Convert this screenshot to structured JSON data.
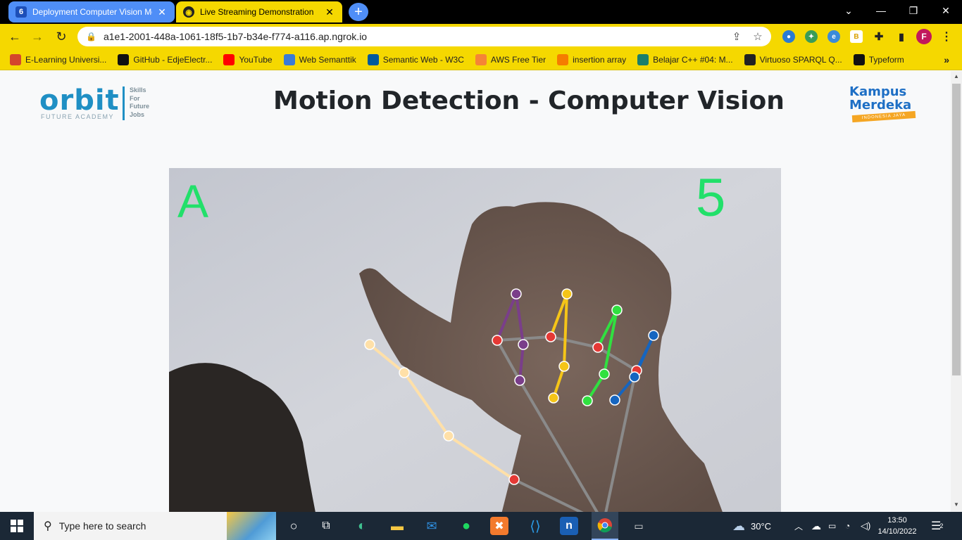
{
  "browser": {
    "tabs": [
      {
        "title": "Deployment Computer Vision Mo",
        "badge": "6",
        "close": "✕",
        "active": false
      },
      {
        "title": "Live Streaming Demonstration",
        "badge": "",
        "close": "✕",
        "active": true
      }
    ],
    "new_tab": "+",
    "window_controls": [
      "⌄",
      "—",
      "❐",
      "✕"
    ],
    "url": "a1e1-2001-448a-1061-18f5-1b7-b34e-f774-a116.ap.ngrok.io",
    "profile_initial": "F",
    "bookmarks": [
      {
        "label": "E-Learning Universi...",
        "icon": "graduation-cap-icon",
        "color": "#d4462c"
      },
      {
        "label": "GitHub - EdjeElectr...",
        "icon": "github-icon",
        "color": "#111111"
      },
      {
        "label": "YouTube",
        "icon": "youtube-icon",
        "color": "#ff0000"
      },
      {
        "label": "Web Semanttik",
        "icon": "network-icon",
        "color": "#3a7bd5"
      },
      {
        "label": "Semantic Web - W3C",
        "icon": "w3c-icon",
        "color": "#005a9c"
      },
      {
        "label": "AWS Free Tier",
        "icon": "aws-box-icon",
        "color": "#f58536"
      },
      {
        "label": "insertion array",
        "icon": "blogger-icon",
        "color": "#f57d00"
      },
      {
        "label": "Belajar C++ #04: M...",
        "icon": "globe-icon",
        "color": "#1b7f6b"
      },
      {
        "label": "Virtuoso SPARQL Q...",
        "icon": "d-letter-icon",
        "color": "#222222"
      },
      {
        "label": "Typeform",
        "icon": "typeform-icon",
        "color": "#111111"
      }
    ],
    "bookmarks_more": "»"
  },
  "page": {
    "title": "Motion Detection - Computer Vision",
    "orbit_logo": {
      "word": "orbit",
      "sub": "FUTURE ACADEMY",
      "tagline": [
        "Skills",
        "For",
        "Future",
        "Jobs"
      ]
    },
    "kampus_logo": {
      "line1": "Kampus",
      "line2": "Merdeka",
      "ribbon": "INDONESIA JAYA"
    },
    "video": {
      "predicted_letter": "A",
      "finger_count": "5",
      "overlay_color": "#22e06a"
    }
  },
  "taskbar": {
    "search_placeholder": "Type here to search",
    "weather": "30°C",
    "time": "13:50",
    "date": "14/10/2022",
    "notification_count": "2"
  }
}
